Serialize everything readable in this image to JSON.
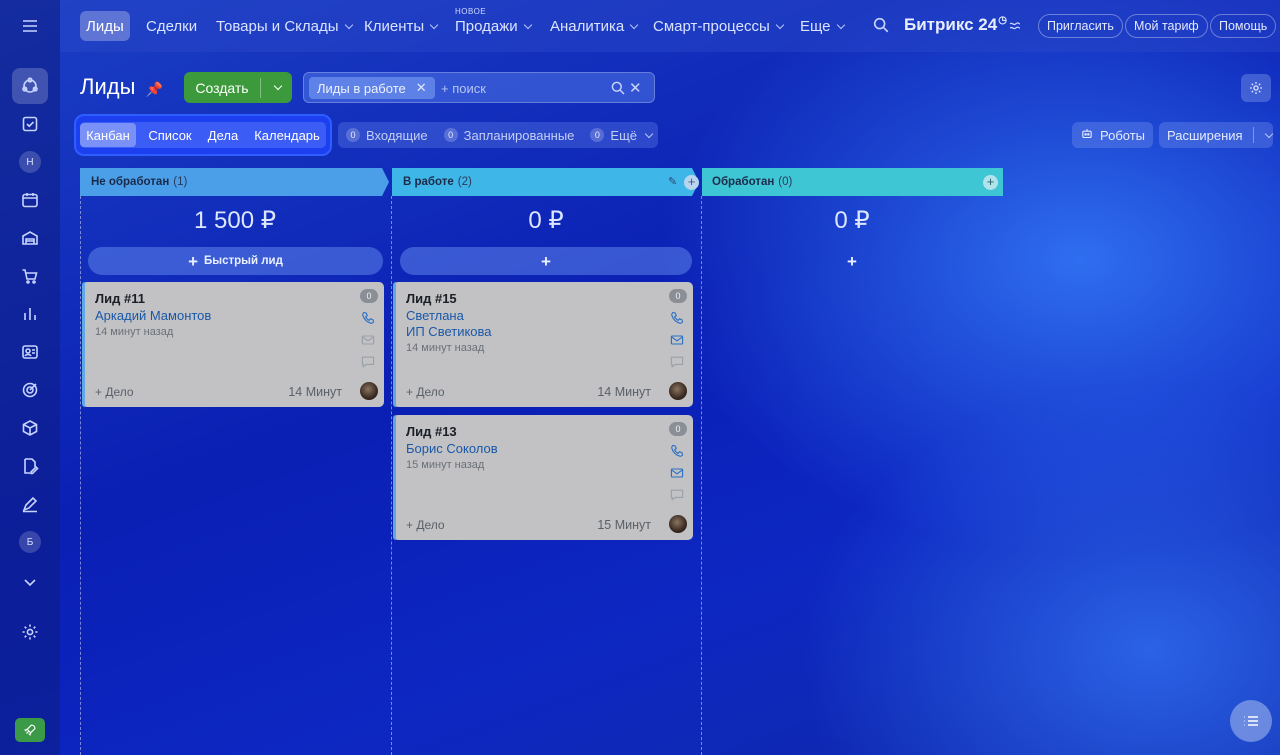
{
  "topnav": {
    "items": [
      "Лиды",
      "Сделки",
      "Товары и Склады",
      "Клиенты",
      "Продажи",
      "Аналитика",
      "Смарт-процессы",
      "Еще"
    ],
    "new_badge": "НОВОЕ",
    "brand": "Битрикс 24",
    "invite": "Пригласить",
    "tariff": "Мой тариф",
    "help": "Помощь"
  },
  "sidebar": {
    "avatar_n": "Н",
    "avatar_b": "Б"
  },
  "page": {
    "title": "Лиды",
    "create": "Создать",
    "filter_tag": "Лиды в работе",
    "search_placeholder": "+ поиск"
  },
  "views": {
    "tabs": [
      "Канбан",
      "Список",
      "Дела",
      "Календарь"
    ],
    "active": "Канбан",
    "counters": [
      {
        "count": "0",
        "label": "Входящие"
      },
      {
        "count": "0",
        "label": "Запланированные"
      },
      {
        "count": "0",
        "label": "Ещё"
      }
    ],
    "robots": "Роботы",
    "extensions": "Расширения"
  },
  "columns": [
    {
      "name": "Не обработан",
      "count": "(1)",
      "sum": "1 500 ₽",
      "quick": "Быстрый лид",
      "color": "#4a9fe8"
    },
    {
      "name": "В работе",
      "count": "(2)",
      "sum": "0 ₽",
      "quick": "",
      "color": "#3fb6e8"
    },
    {
      "name": "Обработан",
      "count": "(0)",
      "sum": "0 ₽",
      "quick": "",
      "color": "#3ec6d4"
    }
  ],
  "cards": [
    {
      "title": "Лид #11",
      "name1": "Аркадий Мамонтов",
      "name2": "",
      "time": "14 минут назад",
      "add": "+ Дело",
      "duration": "14 Минут",
      "badge": "0"
    },
    {
      "title": "Лид #15",
      "name1": "Светлана",
      "name2": "ИП Светикова",
      "time": "14 минут назад",
      "add": "+ Дело",
      "duration": "14 Минут",
      "badge": "0"
    },
    {
      "title": "Лид #13",
      "name1": "Борис Соколов",
      "name2": "",
      "time": "15 минут назад",
      "add": "+ Дело",
      "duration": "15 Минут",
      "badge": "0"
    }
  ]
}
